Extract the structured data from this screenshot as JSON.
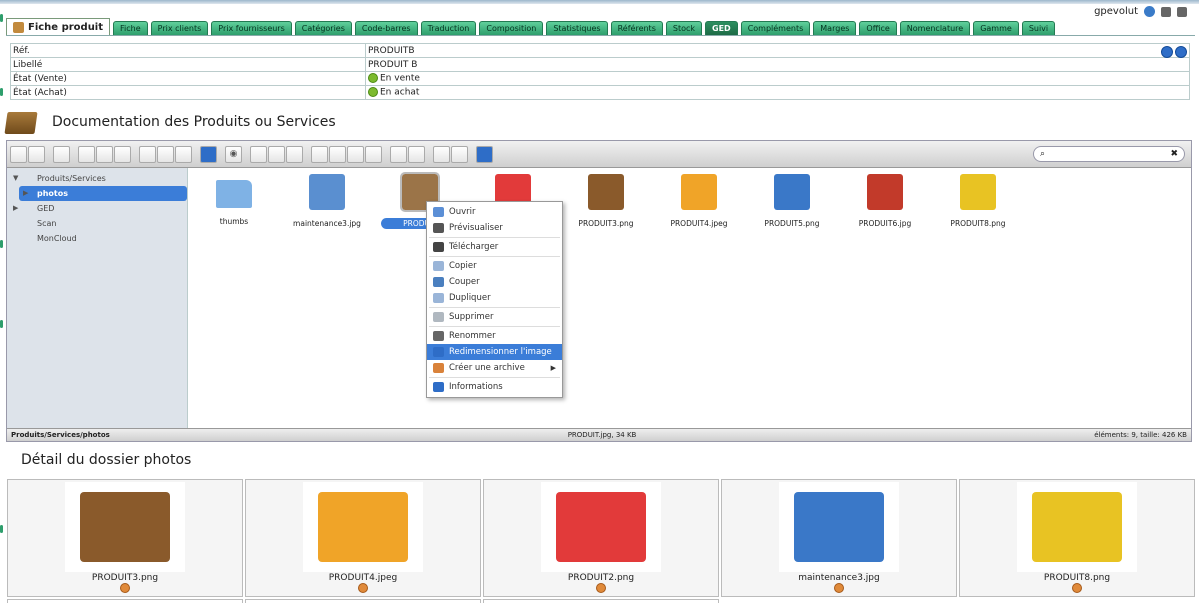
{
  "user": {
    "name": "gpevolut"
  },
  "tabs": {
    "first": "Fiche produit",
    "items": [
      "Fiche",
      "Prix clients",
      "Prix fournisseurs",
      "Catégories",
      "Code-barres",
      "Traduction",
      "Composition",
      "Statistiques",
      "Référents",
      "Stock",
      "GED",
      "Compléments",
      "Marges",
      "Office",
      "Nomenclature",
      "Gamme",
      "Suivi"
    ],
    "active": "GED"
  },
  "props": {
    "ref_label": "Réf.",
    "ref_value": "PRODUITB",
    "libelle_label": "Libellé",
    "libelle_value": "PRODUIT B",
    "vente_label": "État (Vente)",
    "vente_value": "En vente",
    "achat_label": "État (Achat)",
    "achat_value": "En achat"
  },
  "doc_title": "Documentation des Produits ou Services",
  "tree": {
    "root": "Produits/Services",
    "selected": "photos",
    "items": [
      "GED",
      "Scan",
      "MonCloud"
    ]
  },
  "files": [
    {
      "name": "thumbs",
      "icon": "folder-icon",
      "color": "#7fb2e5"
    },
    {
      "name": "maintenance3.jpg",
      "icon": "maintenance-image-icon",
      "color": "#5a8fd0"
    },
    {
      "name": "PRODUIT.jpg",
      "icon": "box-image-icon",
      "color": "#9b7448"
    },
    {
      "name": "",
      "icon": "cleaning-image-icon",
      "color": "#e23a3a"
    },
    {
      "name": "PRODUIT3.png",
      "icon": "box-image-icon",
      "color": "#8a5a2b"
    },
    {
      "name": "PRODUIT4.jpeg",
      "icon": "puzzle-box-image-icon",
      "color": "#f0a428"
    },
    {
      "name": "PRODUIT5.png",
      "icon": "disc-image-icon",
      "color": "#3a78c8"
    },
    {
      "name": "PRODUIT6.jpg",
      "icon": "roll-image-icon",
      "color": "#c23a2a"
    },
    {
      "name": "PRODUIT8.png",
      "icon": "gear-box-image-icon",
      "color": "#e8c323"
    }
  ],
  "selected_file_label": "PRODUIT",
  "context_menu": [
    {
      "label": "Ouvrir",
      "icon": "open-icon",
      "color": "#5b8fd6"
    },
    {
      "label": "Prévisualiser",
      "icon": "eye-icon",
      "color": "#555555",
      "sep_after": true
    },
    {
      "label": "Télécharger",
      "icon": "save-icon",
      "color": "#444444",
      "sep_after": true
    },
    {
      "label": "Copier",
      "icon": "copy-icon",
      "color": "#9ab5d8"
    },
    {
      "label": "Couper",
      "icon": "cut-icon",
      "color": "#4a7fbf"
    },
    {
      "label": "Dupliquer",
      "icon": "duplicate-icon",
      "color": "#9ab5d8",
      "sep_after": true
    },
    {
      "label": "Supprimer",
      "icon": "delete-icon",
      "color": "#b0b8c0",
      "sep_after": true
    },
    {
      "label": "Renommer",
      "icon": "rename-icon",
      "color": "#666666"
    },
    {
      "label": "Redimensionner l'image",
      "icon": "resize-icon",
      "color": "#2e6dc7",
      "highlight": true
    },
    {
      "label": "Créer une archive",
      "icon": "archive-icon",
      "color": "#d9823a",
      "submenu": true,
      "sep_after": true
    },
    {
      "label": "Informations",
      "icon": "info-icon",
      "color": "#2e6dc7"
    }
  ],
  "status": {
    "path": "Produits/Services/photos",
    "file": "PRODUIT.jpg, 34 KB",
    "summary": "éléments: 9, taille: 426 KB"
  },
  "detail_title": "Détail du dossier photos",
  "gallery": [
    {
      "name": "PRODUIT3.png",
      "color": "#8a5a2b"
    },
    {
      "name": "PRODUIT4.jpeg",
      "color": "#f0a428"
    },
    {
      "name": "PRODUIT2.png",
      "color": "#e23a3a"
    },
    {
      "name": "maintenance3.jpg",
      "color": "#3a78c8"
    },
    {
      "name": "PRODUIT8.png",
      "color": "#e8c323"
    }
  ]
}
